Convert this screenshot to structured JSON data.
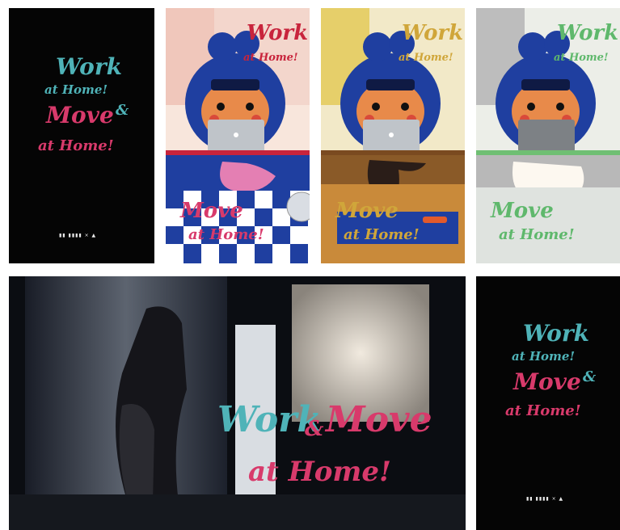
{
  "poster_black": {
    "line1": "Work",
    "line2": "at Home!",
    "line3": "Move",
    "amp": "&",
    "line4": "at Home!",
    "logo": "▮▮ ▮▮▮▮ × ▲"
  },
  "poster_pink": {
    "word1": "Work",
    "word2": "at Home!",
    "word3": "Move",
    "word4": "at Home!"
  },
  "poster_gold": {
    "word1": "Work",
    "word2": "at Home!",
    "word3": "Move",
    "word4": "at Home!"
  },
  "poster_gray": {
    "word1": "Work",
    "word2": "at Home!",
    "word3": "Move",
    "word4": "at Home!"
  },
  "photo": {
    "work": "Work",
    "amp": "&",
    "move": "Move",
    "athome": "at Home!"
  },
  "poster_black_small": {
    "line1": "Work",
    "line2": "at Home!",
    "line3": "Move",
    "amp": "&",
    "line4": "at Home!",
    "logo": "▮▮ ▮▮▮▮ × ▲"
  },
  "colors": {
    "teal": "#4fb3b8",
    "pink": "#d83a6b",
    "blue": "#1f3fa0",
    "skin": "#e88a4a",
    "laptop": "#bfc4c9"
  }
}
